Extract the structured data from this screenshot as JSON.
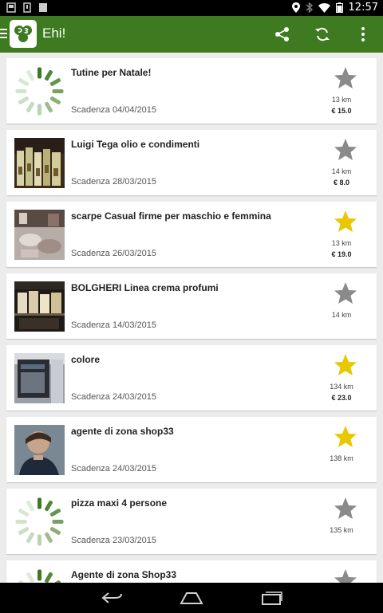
{
  "status_bar": {
    "time": "12:57"
  },
  "action_bar": {
    "title": "Ehi!"
  },
  "colors": {
    "primary": "#3d7a20",
    "star_active": "#e8c800",
    "star_inactive": "#8a8a8a"
  },
  "items": [
    {
      "title": "Tutine per Natale!",
      "date": "Scadenza 04/04/2015",
      "distance": "13 km",
      "price": "€ 15.0",
      "favorite": false,
      "image": "loading-spinner-icon"
    },
    {
      "title": "Luigi Tega olio e condimenti",
      "date": "Scadenza 28/03/2015",
      "distance": "14 km",
      "price": "€ 8.0",
      "favorite": false,
      "image": "photo"
    },
    {
      "title": "scarpe Casual firme per maschio e femmina",
      "date": "Scadenza 26/03/2015",
      "distance": "13 km",
      "price": "€ 19.0",
      "favorite": true,
      "image": "photo"
    },
    {
      "title": "BOLGHERI Linea crema profumi",
      "date": "Scadenza 14/03/2015",
      "distance": "14 km",
      "price": "",
      "favorite": false,
      "image": "photo"
    },
    {
      "title": "colore",
      "date": "Scadenza 24/03/2015",
      "distance": "134 km",
      "price": "€ 23.0",
      "favorite": true,
      "image": "photo"
    },
    {
      "title": "agente di zona shop33",
      "date": "Scadenza 24/03/2015",
      "distance": "138 km",
      "price": "",
      "favorite": true,
      "image": "photo"
    },
    {
      "title": "pizza maxi 4 persone",
      "date": "Scadenza 23/03/2015",
      "distance": "135 km",
      "price": "",
      "favorite": false,
      "image": "loading-spinner-icon"
    },
    {
      "title": "Agente di zona Shop33",
      "date": "",
      "distance": "",
      "price": "",
      "favorite": false,
      "image": "loading-spinner-icon"
    }
  ]
}
